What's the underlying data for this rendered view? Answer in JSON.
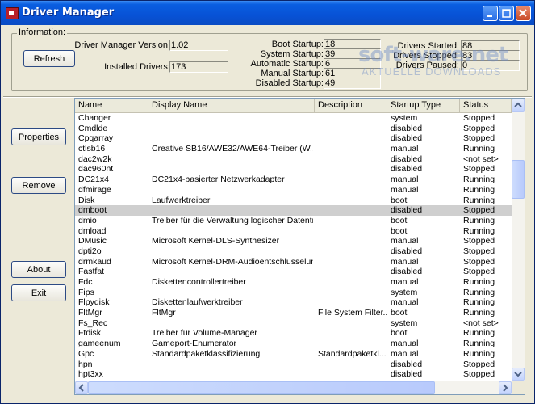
{
  "window": {
    "title": "Driver Manager"
  },
  "info": {
    "group_label": "Information:",
    "refresh_label": "Refresh",
    "version_label": "Driver Manager Version:",
    "version_value": "1.02",
    "installed_label": "Installed Drivers:",
    "installed_value": "173",
    "boot_label": "Boot Startup:",
    "boot_value": "18",
    "system_label": "System Startup:",
    "system_value": "39",
    "auto_label": "Automatic Startup:",
    "auto_value": "6",
    "manual_label": "Manual Startup:",
    "manual_value": "61",
    "disabled_label": "Disabled Startup:",
    "disabled_value": "49",
    "started_label": "Drivers Started:",
    "started_value": "88",
    "stopped_label": "Drivers Stopped:",
    "stopped_value": "83",
    "paused_label": "Drivers Paused:",
    "paused_value": "0"
  },
  "watermark": {
    "main": "soft-ware.net",
    "sub": "AKTUELLE DOWNLOADS"
  },
  "buttons": {
    "properties": "Properties",
    "remove": "Remove",
    "about": "About",
    "exit": "Exit"
  },
  "columns": [
    "Name",
    "Display Name",
    "Description",
    "Startup Type",
    "Status"
  ],
  "selected_row": 9,
  "rows": [
    [
      "Changer",
      "",
      "",
      "system",
      "Stopped"
    ],
    [
      "Cmdlde",
      "",
      "",
      "disabled",
      "Stopped"
    ],
    [
      "Cpqarray",
      "",
      "",
      "disabled",
      "Stopped"
    ],
    [
      "ctlsb16",
      "Creative SB16/AWE32/AWE64-Treiber (W...",
      "",
      "manual",
      "Running"
    ],
    [
      "dac2w2k",
      "",
      "",
      "disabled",
      "<not set>"
    ],
    [
      "dac960nt",
      "",
      "",
      "disabled",
      "Stopped"
    ],
    [
      "DC21x4",
      "DC21x4-basierter Netzwerkadapter",
      "",
      "manual",
      "Running"
    ],
    [
      "dfmirage",
      "",
      "",
      "manual",
      "Running"
    ],
    [
      "Disk",
      "Laufwerktreiber",
      "",
      "boot",
      "Running"
    ],
    [
      "dmboot",
      "",
      "",
      "disabled",
      "Stopped"
    ],
    [
      "dmio",
      "Treiber für die Verwaltung logischer Datentr...",
      "",
      "boot",
      "Running"
    ],
    [
      "dmload",
      "",
      "",
      "boot",
      "Running"
    ],
    [
      "DMusic",
      "Microsoft Kernel-DLS-Synthesizer",
      "",
      "manual",
      "Stopped"
    ],
    [
      "dpti2o",
      "",
      "",
      "disabled",
      "Stopped"
    ],
    [
      "drmkaud",
      "Microsoft Kernel-DRM-Audioentschlüsselung",
      "",
      "manual",
      "Stopped"
    ],
    [
      "Fastfat",
      "",
      "",
      "disabled",
      "Stopped"
    ],
    [
      "Fdc",
      "Diskettencontrollertreiber",
      "",
      "manual",
      "Running"
    ],
    [
      "Fips",
      "",
      "",
      "system",
      "Running"
    ],
    [
      "Flpydisk",
      "Diskettenlaufwerktreiber",
      "",
      "manual",
      "Running"
    ],
    [
      "FltMgr",
      "FltMgr",
      "File System Filter...",
      "boot",
      "Running"
    ],
    [
      "Fs_Rec",
      "",
      "",
      "system",
      "<not set>"
    ],
    [
      "Ftdisk",
      "Treiber für Volume-Manager",
      "",
      "boot",
      "Running"
    ],
    [
      "gameenum",
      "Gameport-Enumerator",
      "",
      "manual",
      "Running"
    ],
    [
      "Gpc",
      "Standardpaketklassifizierung",
      "Standardpaketkl...",
      "manual",
      "Running"
    ],
    [
      "hpn",
      "",
      "",
      "disabled",
      "Stopped"
    ],
    [
      "hpt3xx",
      "",
      "",
      "disabled",
      "Stopped"
    ]
  ]
}
